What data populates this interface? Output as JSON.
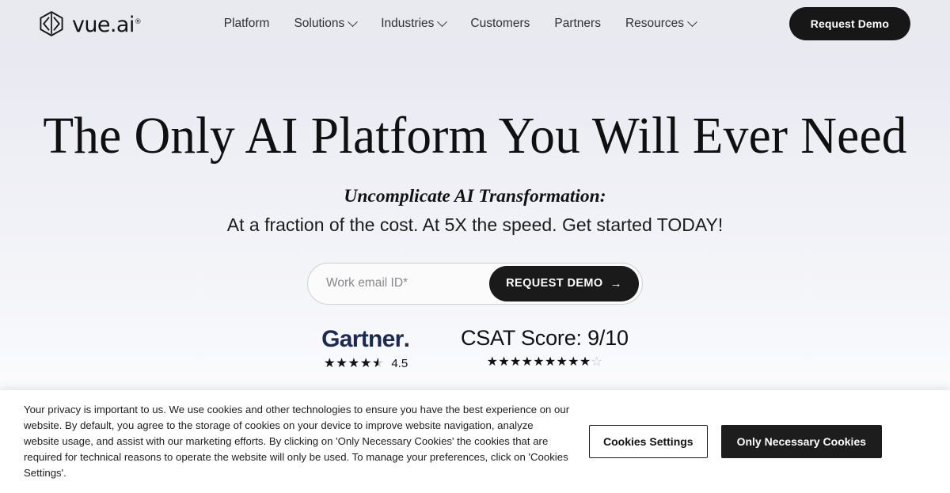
{
  "header": {
    "brand": {
      "name": "vue.ai",
      "registered_mark": "®",
      "logo_icon": "vue-ai-hexagon-logo"
    },
    "nav": [
      {
        "label": "Platform",
        "has_dropdown": false
      },
      {
        "label": "Solutions",
        "has_dropdown": true
      },
      {
        "label": "Industries",
        "has_dropdown": true
      },
      {
        "label": "Customers",
        "has_dropdown": false
      },
      {
        "label": "Partners",
        "has_dropdown": false
      },
      {
        "label": "Resources",
        "has_dropdown": true
      }
    ],
    "cta_label": "Request Demo"
  },
  "hero": {
    "title": "The Only AI Platform You Will Ever Need",
    "subtitle_emphasis": "Uncomplicate AI Transformation:",
    "subtitle": "At a fraction of the cost. At 5X the speed. Get started TODAY!",
    "form": {
      "email_placeholder": "Work email ID*",
      "email_value": "",
      "submit_label": "REQUEST DEMO",
      "submit_arrow": "→"
    }
  },
  "proof": {
    "gartner": {
      "name": "Gartner",
      "name_dot": ".",
      "stars_full": "★★★★",
      "star_half_glyph": "★",
      "rating": "4.5"
    },
    "csat": {
      "title": "CSAT Score: 9/10",
      "stars_full": "★★★★★★★★★",
      "star_empty": "☆"
    }
  },
  "cookie_banner": {
    "message": "Your privacy is important to us. We use cookies and other technologies to ensure you have the best experience on our website. By default, you agree to the storage of cookies on your device to improve website navigation, analyze website usage, and assist with our marketing efforts. By clicking on 'Only Necessary Cookies' the cookies that are required for technical reasons to operate the website will only be used. To manage your preferences, click on 'Cookies Settings'.",
    "settings_label": "Cookies Settings",
    "necessary_label": "Only Necessary Cookies",
    "close_glyph": "✕"
  },
  "colors": {
    "brand_dark": "#171717",
    "gartner_navy": "#1b2a52",
    "hero_bg_top": "#e9eaef",
    "hero_bg_bottom": "#ffffff",
    "star_filled": "#121212",
    "star_empty": "#b9babd"
  }
}
